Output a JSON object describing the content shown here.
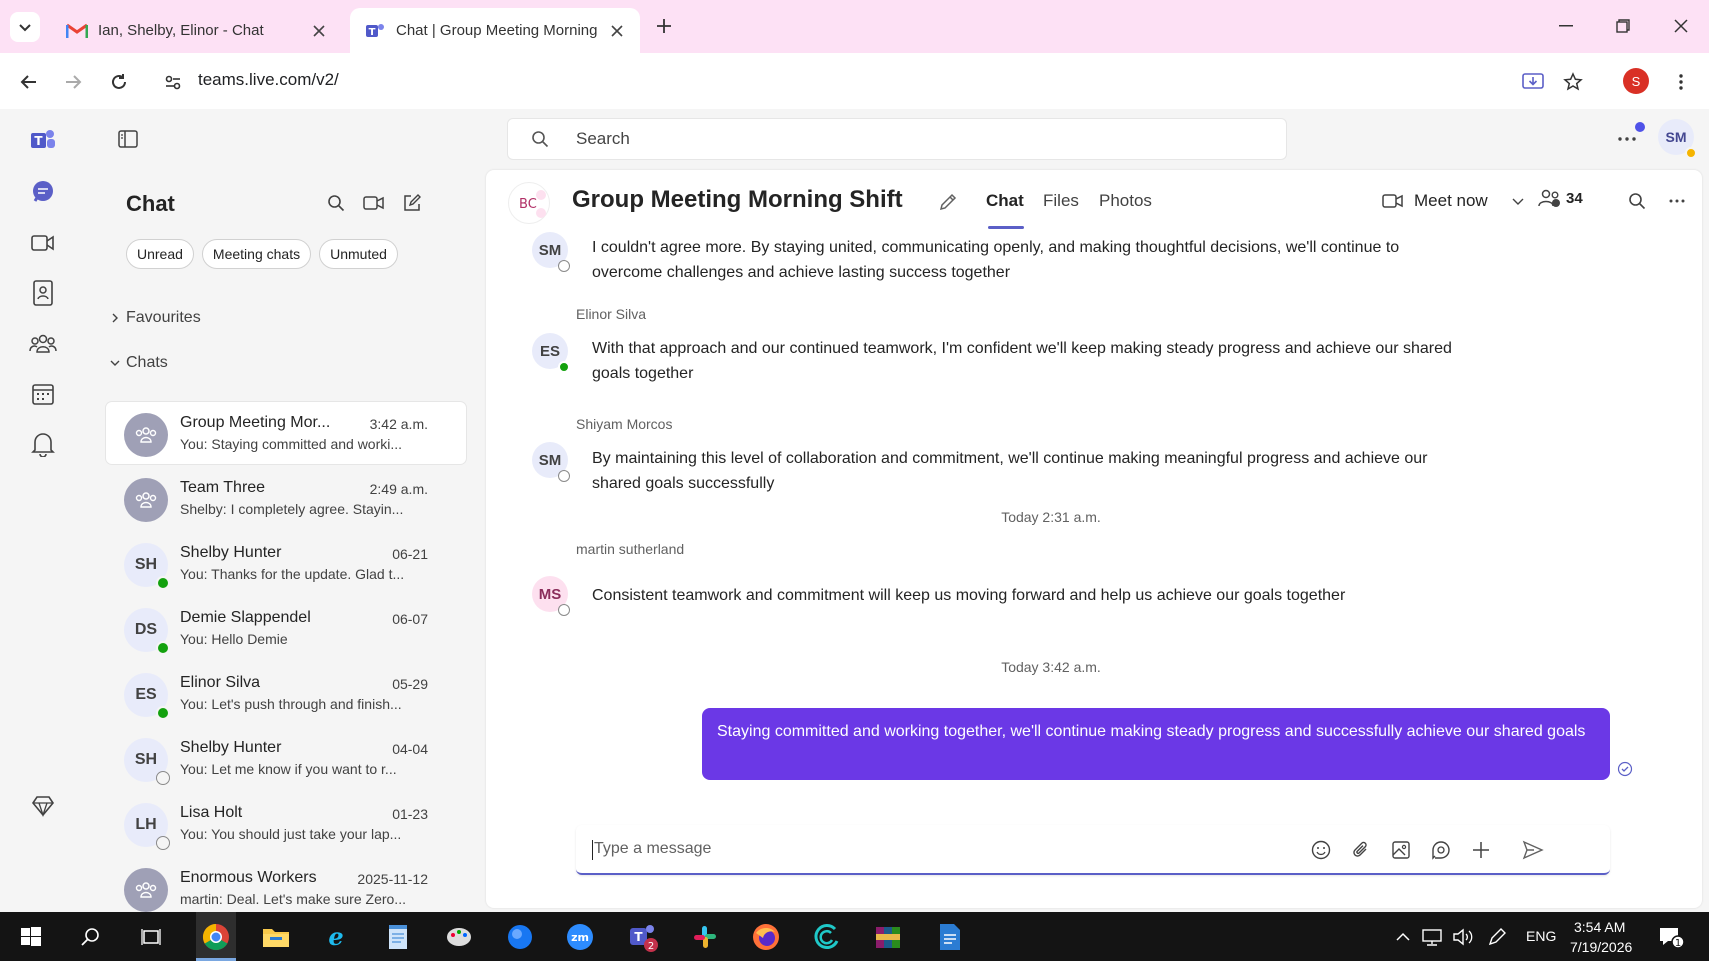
{
  "browser": {
    "tabs": [
      {
        "title": "Ian, Shelby, Elinor - Chat",
        "favicon": "gmail-icon",
        "active": false
      },
      {
        "title": "Chat | Group Meeting Morning Shift",
        "favicon": "teams-icon",
        "active": true
      }
    ],
    "url": "teams.live.com/v2/",
    "profile_initial": "S"
  },
  "teams": {
    "search_placeholder": "Search",
    "me_initials": "SM",
    "rail": [
      "teams-logo-icon",
      "chat-icon",
      "meet-icon",
      "contacts-icon",
      "communities-icon",
      "calendar-icon",
      "activity-icon",
      "premium-icon"
    ],
    "chatlist": {
      "title": "Chat",
      "filters": [
        "Unread",
        "Meeting chats",
        "Unmuted"
      ],
      "sections": {
        "favourites": "Favourites",
        "chats": "Chats"
      },
      "items": [
        {
          "name": "Group Meeting Mor...",
          "time": "3:42 a.m.",
          "preview": "You: Staying committed and worki...",
          "initials": "",
          "type": "group",
          "status": "",
          "selected": true
        },
        {
          "name": "Team Three",
          "time": "2:49 a.m.",
          "preview": "Shelby: I completely agree. Stayin...",
          "initials": "",
          "type": "group",
          "status": "",
          "selected": false
        },
        {
          "name": "Shelby Hunter",
          "time": "06-21",
          "preview": "You: Thanks for the update. Glad t...",
          "initials": "SH",
          "type": "person",
          "status": "online",
          "selected": false
        },
        {
          "name": "Demie Slappendel",
          "time": "06-07",
          "preview": "You: Hello Demie",
          "initials": "DS",
          "type": "person",
          "status": "online",
          "selected": false
        },
        {
          "name": "Elinor Silva",
          "time": "05-29",
          "preview": "You: Let's push through and finish...",
          "initials": "ES",
          "type": "person",
          "status": "online",
          "selected": false
        },
        {
          "name": "Shelby Hunter",
          "time": "04-04",
          "preview": "You: Let me know if you want to r...",
          "initials": "SH",
          "type": "person",
          "status": "away",
          "selected": false
        },
        {
          "name": "Lisa Holt",
          "time": "01-23",
          "preview": "You: You should just take your lap...",
          "initials": "LH",
          "type": "person",
          "status": "away",
          "selected": false
        },
        {
          "name": "Enormous Workers",
          "time": "2025-11-12",
          "preview": "martin: Deal. Let's make sure Zero...",
          "initials": "",
          "type": "group",
          "status": "",
          "selected": false
        }
      ]
    },
    "conversation": {
      "avatar_text": "BC",
      "title": "Group Meeting Morning Shift",
      "tabs": [
        "Chat",
        "Files",
        "Photos"
      ],
      "meet_now": "Meet now",
      "participants": "34",
      "messages": [
        {
          "initials": "SM",
          "sender": "",
          "status": "away",
          "text": "I couldn't agree more. By staying united, communicating openly, and making thoughtful decisions, we'll continue to overcome challenges and achieve lasting success together"
        },
        {
          "initials": "ES",
          "sender": "Elinor Silva",
          "status": "online",
          "text": "With that approach and our continued teamwork, I'm confident we'll keep making steady progress and achieve our shared goals together"
        },
        {
          "initials": "SM",
          "sender": "Shiyam Morcos",
          "status": "away",
          "text": "By maintaining this level of collaboration and commitment, we'll continue making meaningful progress and achieve our shared goals successfully"
        },
        {
          "initials": "MS",
          "sender": "martin sutherland",
          "status": "away",
          "text": "Consistent teamwork and commitment will keep us moving forward and help us achieve our goals together"
        }
      ],
      "timestamps": [
        "Today 2:31 a.m.",
        "Today 3:42 a.m."
      ],
      "my_message": "Staying committed and working together, we'll continue making steady progress and successfully achieve our shared goals",
      "composer_placeholder": "Type a message"
    }
  },
  "taskbar": {
    "lang": "ENG",
    "time": "3:54 AM",
    "date": "7/19/2026",
    "notifications": "1",
    "teams_badge": "2"
  },
  "colors": {
    "tab_strip": "#fde1f5",
    "accent": "#5b5fc7",
    "my_bubble": "#6b38e6",
    "online": "#13a10e"
  }
}
